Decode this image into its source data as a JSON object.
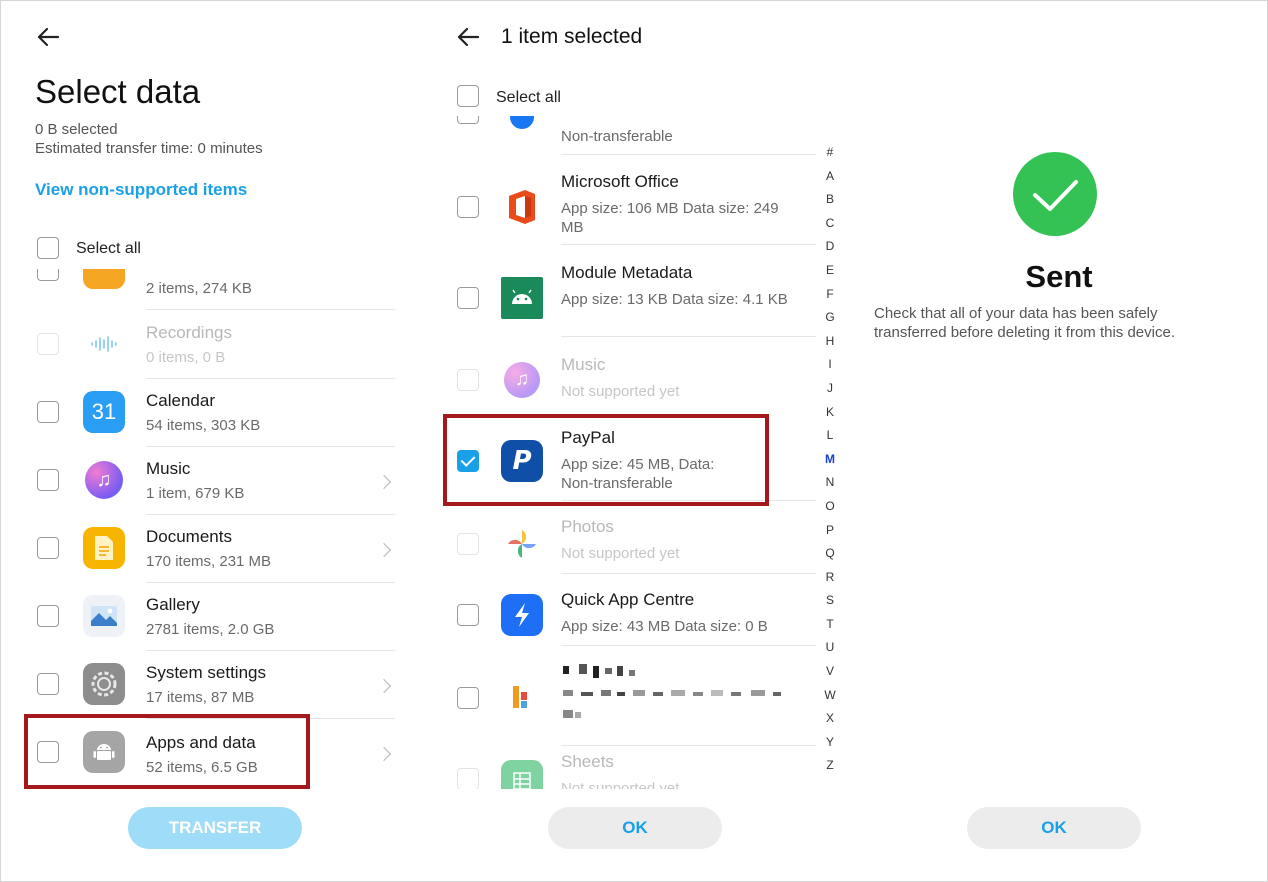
{
  "select_data": {
    "title": "Select data",
    "selected_size": "0 B selected",
    "estimated_time": "Estimated transfer time: 0 minutes",
    "non_supported_link": "View non-supported items",
    "select_all": "Select all",
    "items": [
      {
        "name": "",
        "meta": "2 items, 274 KB",
        "icon": "notes-icon"
      },
      {
        "name": "Recordings",
        "meta": "0 items, 0 B",
        "icon": "recorder-icon",
        "disabled": true
      },
      {
        "name": "Calendar",
        "meta": "54 items, 303 KB",
        "icon": "calendar-icon",
        "icon_text": "31"
      },
      {
        "name": "Music",
        "meta": "1 item, 679 KB",
        "icon": "music-icon"
      },
      {
        "name": "Documents",
        "meta": "170 items, 231 MB",
        "icon": "documents-icon"
      },
      {
        "name": "Gallery",
        "meta": "2781 items, 2.0 GB",
        "icon": "gallery-icon"
      },
      {
        "name": "System settings",
        "meta": "17 items, 87 MB",
        "icon": "settings-icon"
      },
      {
        "name": "Apps and data",
        "meta": "52 items, 6.5 GB",
        "icon": "android-icon"
      }
    ],
    "transfer_button": "TRANSFER"
  },
  "app_list": {
    "title": "1 item selected",
    "select_all": "Select all",
    "items": [
      {
        "name": "",
        "meta": "Non-transferable",
        "icon": "messenger-icon"
      },
      {
        "name": "Microsoft Office",
        "meta": "App size: 106 MB Data size: 249 MB",
        "icon": "office-icon"
      },
      {
        "name": "Module Metadata",
        "meta": "App size: 13 KB Data size: 4.1 KB",
        "icon": "android-module-icon"
      },
      {
        "name": "Music",
        "meta": "Not supported yet",
        "icon": "music-icon",
        "disabled": true
      },
      {
        "name": "PayPal",
        "meta": "App size: 45 MB, Data: Non-transferable",
        "icon": "paypal-icon",
        "checked": true
      },
      {
        "name": "Photos",
        "meta": "Not supported yet",
        "icon": "photos-icon",
        "disabled": true
      },
      {
        "name": "Quick App Centre",
        "meta": "App size: 43 MB Data size: 0 B",
        "icon": "quick-app-icon"
      },
      {
        "name": "",
        "meta": "",
        "icon": "redacted-app-icon"
      },
      {
        "name": "Sheets",
        "meta": "Not supported yet",
        "icon": "sheets-icon",
        "disabled": true
      }
    ],
    "alphabet": [
      "#",
      "A",
      "B",
      "C",
      "D",
      "E",
      "F",
      "G",
      "H",
      "I",
      "J",
      "K",
      "L",
      "M",
      "N",
      "O",
      "P",
      "Q",
      "R",
      "S",
      "T",
      "U",
      "V",
      "W",
      "X",
      "Y",
      "Z"
    ],
    "alphabet_active": "M",
    "ok_button": "OK"
  },
  "sent": {
    "title": "Sent",
    "message": "Check that all of your data has been safely transferred before deleting it from this device.",
    "ok_button": "OK"
  },
  "colors": {
    "accent": "#1aa0e6",
    "highlight": "#a3191c",
    "success": "#34c254"
  }
}
